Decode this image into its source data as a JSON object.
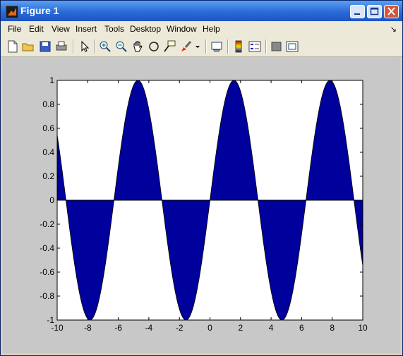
{
  "window": {
    "title": "Figure 1"
  },
  "menu": [
    "File",
    "Edit",
    "View",
    "Insert",
    "Tools",
    "Desktop",
    "Window",
    "Help"
  ],
  "toolbar_icons": [
    "new-file-icon",
    "open-folder-icon",
    "save-icon",
    "print-icon",
    "pointer-icon",
    "zoom-in-icon",
    "zoom-out-icon",
    "pan-hand-icon",
    "rotate-3d-icon",
    "data-cursor-icon",
    "brush-icon",
    "dropdown-arrow-icon",
    "link-plot-icon",
    "colorbar-icon",
    "legend-icon",
    "hide-plot-tools-icon",
    "show-plot-tools-icon"
  ],
  "colors": {
    "fill": "#00009c",
    "axes_bg": "#ffffff",
    "figure_bg": "#c8c8c8",
    "title_bar": "#2a6ad8"
  },
  "chart_data": {
    "type": "area",
    "function": "sin(x)",
    "x_range": [
      -10,
      10
    ],
    "samples": [
      [
        -10,
        0.544
      ],
      [
        -9.42,
        0.0
      ],
      [
        -8,
        -0.989
      ],
      [
        -7.85,
        -1.0
      ],
      [
        -6.28,
        0.0
      ],
      [
        -4.71,
        1.0
      ],
      [
        -3.14,
        0.0
      ],
      [
        -1.57,
        -1.0
      ],
      [
        0,
        0.0
      ],
      [
        1.57,
        1.0
      ],
      [
        3.14,
        0.0
      ],
      [
        4.71,
        -1.0
      ],
      [
        6.28,
        0.0
      ],
      [
        7.85,
        1.0
      ],
      [
        9.42,
        0.0
      ],
      [
        10,
        -0.544
      ]
    ],
    "xlim": [
      -10,
      10
    ],
    "ylim": [
      -1,
      1
    ],
    "xticks": [
      "-10",
      "-8",
      "-6",
      "-4",
      "-2",
      "0",
      "2",
      "4",
      "6",
      "8",
      "10"
    ],
    "yticks": [
      "1",
      "0.8",
      "0.6",
      "0.4",
      "0.2",
      "0",
      "-0.2",
      "-0.4",
      "-0.6",
      "-0.8",
      "-1"
    ],
    "grid": false
  }
}
